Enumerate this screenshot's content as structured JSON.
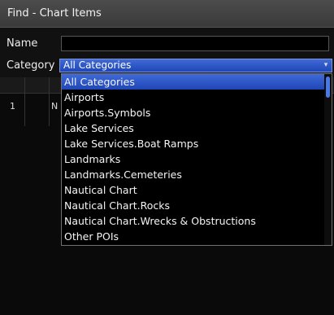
{
  "window": {
    "title": "Find - Chart Items"
  },
  "form": {
    "name_label": "Name",
    "name_value": "",
    "category_label": "Category",
    "category_value": "All Categories"
  },
  "grid": {
    "row_index": "1",
    "row_name": "N"
  },
  "dropdown": {
    "options": [
      "All Categories",
      "Airports",
      "Airports.Symbols",
      "Lake Services",
      "Lake Services.Boat Ramps",
      "Landmarks",
      "Landmarks.Cemeteries",
      "Nautical Chart",
      "Nautical Chart.Rocks",
      "Nautical Chart.Wrecks & Obstructions",
      "Other POIs"
    ],
    "selected_option": "All Categories"
  },
  "colors": {
    "highlight": "#2c55c8",
    "scroll_thumb": "#4a78e6"
  },
  "icons": {
    "dropdown_arrow": "chevron-down-icon"
  }
}
